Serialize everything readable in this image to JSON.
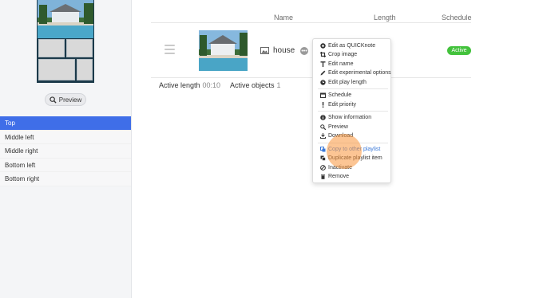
{
  "left_panel": {
    "preview_label": "Preview",
    "positions": [
      "Top",
      "Middle left",
      "Middle right",
      "Bottom left",
      "Bottom right"
    ],
    "active_position": "Top"
  },
  "table": {
    "headers": {
      "name": "Name",
      "length": "Length",
      "schedule": "Schedule"
    },
    "item": {
      "name": "house",
      "status": "Active"
    },
    "stats": {
      "active_length_label": "Active length",
      "active_length_value": "00:10",
      "active_objects_label": "Active objects",
      "active_objects_value": "1"
    }
  },
  "context_menu": {
    "groups": [
      [
        {
          "label": "Edit as QUICKnote",
          "icon": "quicknote-icon"
        },
        {
          "label": "Crop image",
          "icon": "crop-icon"
        },
        {
          "label": "Edit name",
          "icon": "text-icon"
        },
        {
          "label": "Edit experimental options",
          "icon": "pencil-icon"
        },
        {
          "label": "Edit play length",
          "icon": "clock-icon"
        }
      ],
      [
        {
          "label": "Schedule",
          "icon": "calendar-icon"
        },
        {
          "label": "Edit priority",
          "icon": "exclamation-icon"
        }
      ],
      [
        {
          "label": "Show information",
          "icon": "info-icon"
        },
        {
          "label": "Preview",
          "icon": "preview-icon"
        },
        {
          "label": "Download",
          "icon": "download-icon"
        }
      ],
      [
        {
          "label": "Copy to other playlist",
          "icon": "copy-icon"
        },
        {
          "label": "Duplicate playlist item",
          "icon": "duplicate-icon"
        },
        {
          "label": "Inactivate",
          "icon": "inactivate-icon"
        },
        {
          "label": "Remove",
          "icon": "trash-icon"
        }
      ]
    ],
    "hovered": "Copy to other playlist"
  },
  "colors": {
    "accent": "#3f6ee8",
    "active_badge": "#43c23c",
    "link_blue": "#3a78d8",
    "cursor_highlight": "#fa963c"
  }
}
